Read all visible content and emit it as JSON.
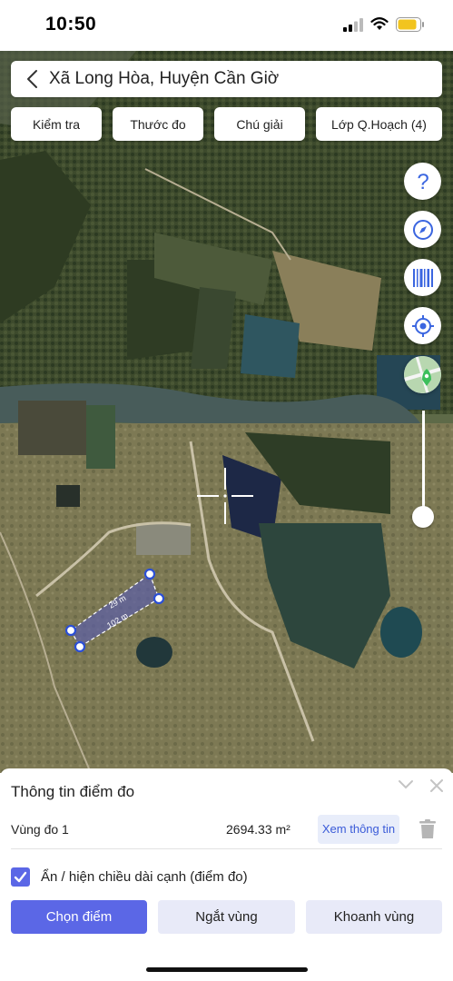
{
  "status_bar": {
    "time": "10:50"
  },
  "header": {
    "title": "Xã Long Hòa, Huyện Cần Giờ"
  },
  "toolbar": [
    {
      "label": "Kiểm tra"
    },
    {
      "label": "Thước đo"
    },
    {
      "label": "Chú giải"
    },
    {
      "label": "Lớp Q.Hoạch (4)"
    }
  ],
  "side_controls": [
    "help-icon",
    "compass-icon",
    "barcode-icon",
    "locate-icon",
    "map-layer-icon"
  ],
  "measure": {
    "edge_1": "29 m",
    "edge_2": "102 m"
  },
  "panel": {
    "title": "Thông tin điểm đo",
    "row_label": "Vùng đo 1",
    "row_value": "2694.33 m²",
    "info_button": "Xem thông tin",
    "checkbox_label": "Ẩn / hiện chiều dài cạnh (điểm đo)",
    "checkbox_checked": true,
    "buttons": [
      "Chọn điểm",
      "Ngắt vùng",
      "Khoanh vùng"
    ]
  },
  "colors": {
    "accent": "#5b67e6",
    "link": "#3a5bd8",
    "icon_blue": "#3b66e0"
  }
}
